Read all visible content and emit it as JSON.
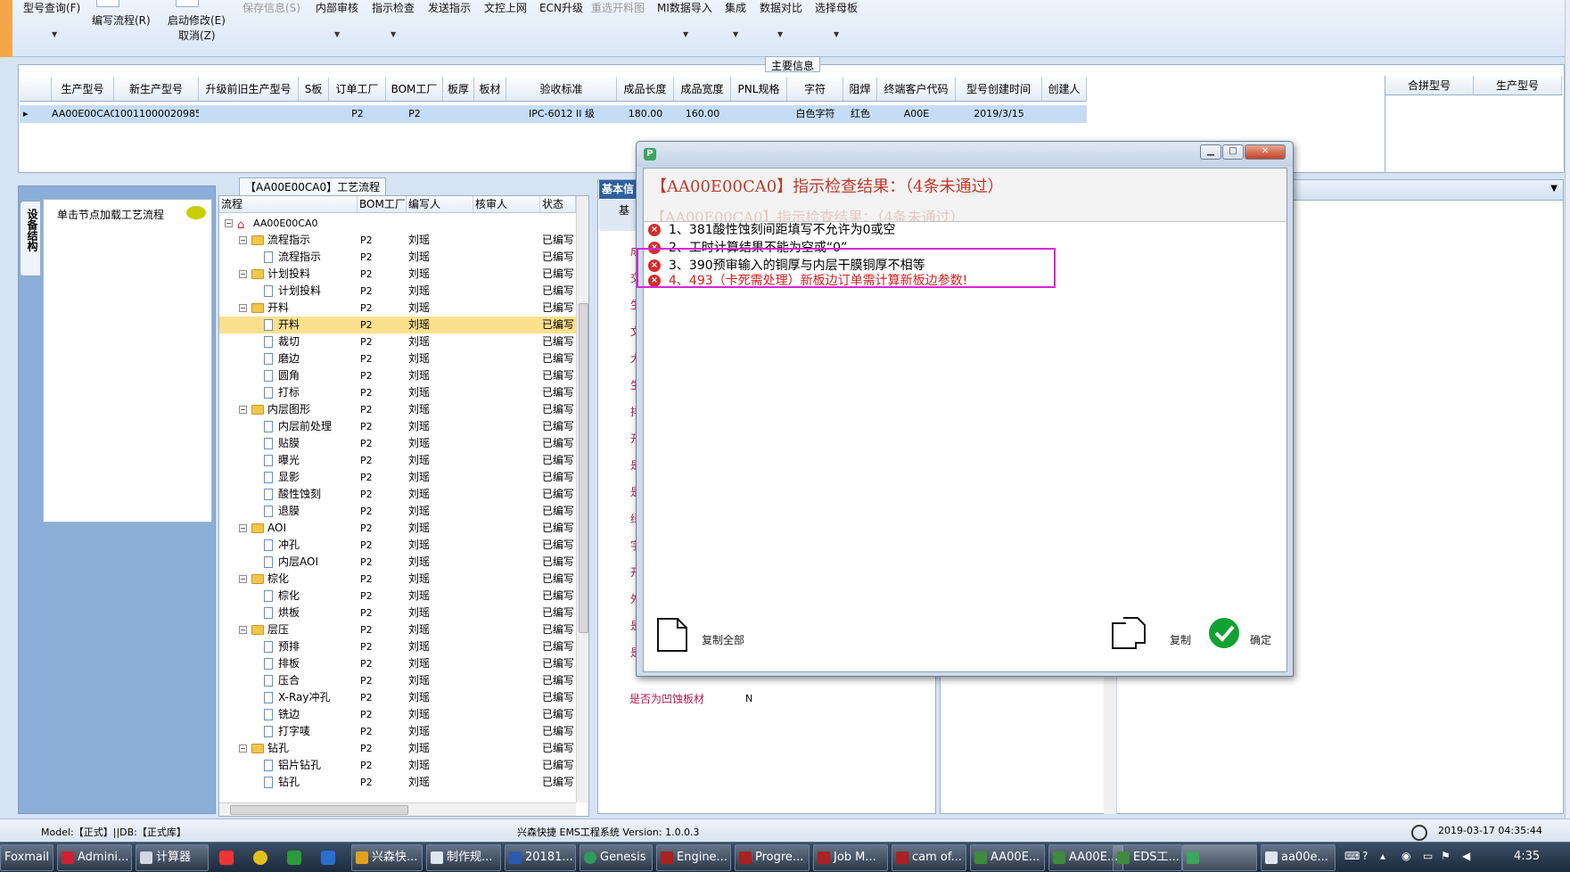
{
  "toolbar": {
    "items": [
      "型号查询(F)",
      "编写流程(R)",
      "启动修改(E)",
      "取消(Z)",
      "保存信息(S)",
      "内部审核",
      "指示检查",
      "发送指示",
      "文控上网",
      "ECN升级",
      "重选开料图",
      "MI数据导入",
      "集成",
      "数据对比",
      "选择母板"
    ]
  },
  "main_info": {
    "title": "主要信息",
    "columns": [
      "生产型号",
      "新生产型号",
      "升级前旧生产型号",
      "S板",
      "订单工厂",
      "BOM工厂",
      "板厚",
      "板材",
      "验收标准",
      "成品长度",
      "成品宽度",
      "PNL规格",
      "字符",
      "阻焊",
      "终端客户代码",
      "型号创建时间",
      "创建人"
    ],
    "row": [
      "AA00E00CA0",
      "10011000020985",
      "",
      "",
      "P2",
      "P2",
      "",
      "",
      "IPC-6012 II 级",
      "180.00",
      "160.00",
      "",
      "白色字符",
      "红色",
      "A00E",
      "2019/3/15",
      ""
    ],
    "merge_columns": [
      "合拼型号",
      "生产型号"
    ]
  },
  "left_panel": {
    "tab": "设备结构",
    "hint": "单击节点加载工艺流程"
  },
  "process_panel": {
    "title": "【AA00E00CA0】工艺流程",
    "columns": [
      "流程",
      "BOM工厂",
      "编写人",
      "核审人",
      "状态"
    ],
    "root": "AA00E00CA0",
    "rows": [
      {
        "name": "流程指示",
        "level": 1,
        "type": "folder",
        "factory": "P2",
        "writer": "刘瑶",
        "status": "已编写"
      },
      {
        "name": "流程指示",
        "level": 2,
        "type": "doc",
        "factory": "P2",
        "writer": "刘瑶",
        "status": "已编写"
      },
      {
        "name": "计划投料",
        "level": 1,
        "type": "folder",
        "factory": "P2",
        "writer": "刘瑶",
        "status": "已编写"
      },
      {
        "name": "计划投料",
        "level": 2,
        "type": "doc",
        "factory": "P2",
        "writer": "刘瑶",
        "status": "已编写"
      },
      {
        "name": "开料",
        "level": 1,
        "type": "folder",
        "factory": "P2",
        "writer": "刘瑶",
        "status": "已编写"
      },
      {
        "name": "开料",
        "level": 2,
        "type": "doc",
        "factory": "P2",
        "writer": "刘瑶",
        "status": "已编写",
        "selected": true
      },
      {
        "name": "裁切",
        "level": 2,
        "type": "doc",
        "factory": "P2",
        "writer": "刘瑶",
        "status": "已编写"
      },
      {
        "name": "磨边",
        "level": 2,
        "type": "doc",
        "factory": "P2",
        "writer": "刘瑶",
        "status": "已编写"
      },
      {
        "name": "圆角",
        "level": 2,
        "type": "doc",
        "factory": "P2",
        "writer": "刘瑶",
        "status": "已编写"
      },
      {
        "name": "打标",
        "level": 2,
        "type": "doc",
        "factory": "P2",
        "writer": "刘瑶",
        "status": "已编写"
      },
      {
        "name": "内层图形",
        "level": 1,
        "type": "folder",
        "factory": "P2",
        "writer": "刘瑶",
        "status": "已编写"
      },
      {
        "name": "内层前处理",
        "level": 2,
        "type": "doc",
        "factory": "P2",
        "writer": "刘瑶",
        "status": "已编写"
      },
      {
        "name": "贴膜",
        "level": 2,
        "type": "doc",
        "factory": "P2",
        "writer": "刘瑶",
        "status": "已编写"
      },
      {
        "name": "曝光",
        "level": 2,
        "type": "doc",
        "factory": "P2",
        "writer": "刘瑶",
        "status": "已编写"
      },
      {
        "name": "显影",
        "level": 2,
        "type": "doc",
        "factory": "P2",
        "writer": "刘瑶",
        "status": "已编写"
      },
      {
        "name": "酸性蚀刻",
        "level": 2,
        "type": "doc",
        "factory": "P2",
        "writer": "刘瑶",
        "status": "已编写"
      },
      {
        "name": "退膜",
        "level": 2,
        "type": "doc",
        "factory": "P2",
        "writer": "刘瑶",
        "status": "已编写"
      },
      {
        "name": "AOI",
        "level": 1,
        "type": "folder",
        "factory": "P2",
        "writer": "刘瑶",
        "status": "已编写"
      },
      {
        "name": "冲孔",
        "level": 2,
        "type": "doc",
        "factory": "P2",
        "writer": "刘瑶",
        "status": "已编写"
      },
      {
        "name": "内层AOI",
        "level": 2,
        "type": "doc",
        "factory": "P2",
        "writer": "刘瑶",
        "status": "已编写"
      },
      {
        "name": "棕化",
        "level": 1,
        "type": "folder",
        "factory": "P2",
        "writer": "刘瑶",
        "status": "已编写"
      },
      {
        "name": "棕化",
        "level": 2,
        "type": "doc",
        "factory": "P2",
        "writer": "刘瑶",
        "status": "已编写"
      },
      {
        "name": "烘板",
        "level": 2,
        "type": "doc",
        "factory": "P2",
        "writer": "刘瑶",
        "status": "已编写"
      },
      {
        "name": "层压",
        "level": 1,
        "type": "folder",
        "factory": "P2",
        "writer": "刘瑶",
        "status": "已编写"
      },
      {
        "name": "预排",
        "level": 2,
        "type": "doc",
        "factory": "P2",
        "writer": "刘瑶",
        "status": "已编写"
      },
      {
        "name": "排板",
        "level": 2,
        "type": "doc",
        "factory": "P2",
        "writer": "刘瑶",
        "status": "已编写"
      },
      {
        "name": "压合",
        "level": 2,
        "type": "doc",
        "factory": "P2",
        "writer": "刘瑶",
        "status": "已编写"
      },
      {
        "name": "X-Ray冲孔",
        "level": 2,
        "type": "doc",
        "factory": "P2",
        "writer": "刘瑶",
        "status": "已编写"
      },
      {
        "name": "铣边",
        "level": 2,
        "type": "doc",
        "factory": "P2",
        "writer": "刘瑶",
        "status": "已编写"
      },
      {
        "name": "打字唛",
        "level": 2,
        "type": "doc",
        "factory": "P2",
        "writer": "刘瑶",
        "status": "已编写"
      },
      {
        "name": "钻孔",
        "level": 1,
        "type": "folder",
        "factory": "P2",
        "writer": "刘瑶",
        "status": "已编写"
      },
      {
        "name": "铝片钻孔",
        "level": 2,
        "type": "doc",
        "factory": "P2",
        "writer": "刘瑶",
        "status": "已编写"
      },
      {
        "name": "钻孔",
        "level": 2,
        "type": "doc",
        "factory": "P2",
        "writer": "刘瑶",
        "status": "已编写"
      }
    ]
  },
  "basic_panel": {
    "tab": "基本信",
    "sub": "基",
    "left_chars": [
      "成",
      "交",
      "生",
      "文",
      "大",
      "生",
      "排",
      "开",
      "是",
      "是",
      "绿",
      "字",
      "开",
      "外",
      "是",
      "是"
    ],
    "last_label": "是否为凹蚀板材",
    "last_value": "N"
  },
  "dialog": {
    "heading": "【AA00E00CA0】指示检查结果：（4条未通过）",
    "heading_ghost": "【AA00E00CA0】指示检查结果：（4条未通过）",
    "errors": [
      {
        "text": "1、381酸性蚀刻间距填写不允许为0或空"
      },
      {
        "text": "2、工时计算结果不能为空或“0”"
      },
      {
        "text": "3、390预审输入的铜厚与内层干膜铜厚不相等"
      },
      {
        "text": "4、493（卡死需处理）新板边订单需计算新板边参数!"
      }
    ],
    "copy_all": "复制全部",
    "copy": "复制",
    "ok": "确定"
  },
  "statusbar": {
    "left": "Model:【正式】||DB:【正式库】",
    "center": "兴森快捷 EMS工程系统 Version: 1.0.0.3",
    "datetime": "2019-03-17 04:35:44"
  },
  "taskbar": {
    "items": [
      "Foxmail",
      "Admini...",
      "计算器",
      "兴森快...",
      "制作规...",
      "20181...",
      "Genesis",
      "Engine...",
      "Progre...",
      "Job M...",
      "cam of...",
      "AA00E...",
      "AA00E...",
      "EDS工...",
      "",
      "aa00e..."
    ],
    "time": "4:35"
  }
}
